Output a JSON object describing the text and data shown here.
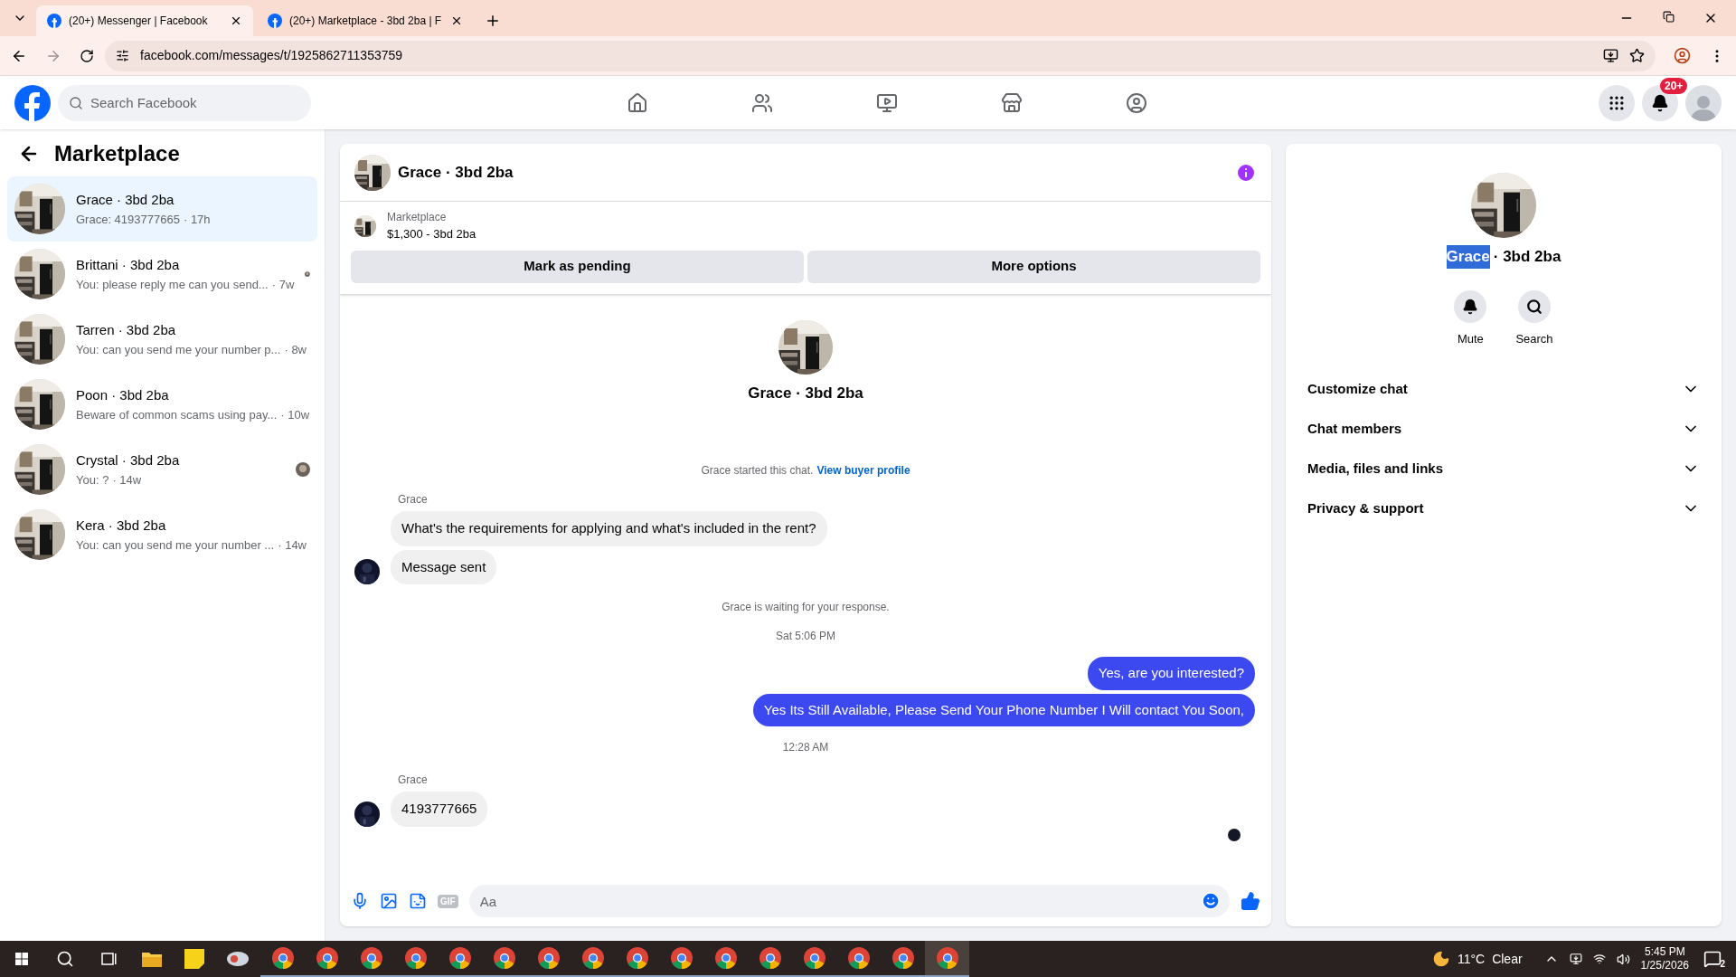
{
  "browser": {
    "tabs": [
      {
        "title": "(20+) Messenger | Facebook",
        "selected": true
      },
      {
        "title": "(20+) Marketplace - 3bd 2ba | F",
        "selected": false
      }
    ],
    "url": "facebook.com/messages/t/1925862711353759"
  },
  "topbar": {
    "search": {
      "placeholder": "Search Facebook"
    },
    "nav": [
      {
        "kind": "home",
        "selected": false
      },
      {
        "kind": "friends",
        "selected": false
      },
      {
        "kind": "video",
        "selected": false
      },
      {
        "kind": "marketplace",
        "selected": false
      },
      {
        "kind": "groups",
        "selected": false
      }
    ],
    "notification_badge": "20+"
  },
  "sidebar": {
    "title": "Marketplace",
    "items": [
      {
        "name": "Grace · 3bd 2ba",
        "preview": "Grace: 4193777665",
        "time": "· 17h",
        "selected": true,
        "seen_avatar": false
      },
      {
        "name": "Brittani · 3bd 2ba",
        "preview": "You: please reply me can you send...",
        "time": "· 7w",
        "selected": false,
        "seen_avatar": true
      },
      {
        "name": "Tarren · 3bd 2ba",
        "preview": "You: can you send me your number p...",
        "time": "· 8w",
        "selected": false,
        "seen_avatar": false
      },
      {
        "name": "Poon · 3bd 2ba",
        "preview": "Beware of common scams using pay...",
        "time": "· 10w",
        "selected": false,
        "seen_avatar": false
      },
      {
        "name": "Crystal · 3bd 2ba",
        "preview": "You: ?",
        "time": "· 14w",
        "selected": false,
        "seen_avatar": true
      },
      {
        "name": "Kera · 3bd 2ba",
        "preview": "You: can you send me your number ...",
        "time": "· 14w",
        "selected": false,
        "seen_avatar": false
      }
    ]
  },
  "chat": {
    "title": "Grace · 3bd 2ba",
    "listing": {
      "label": "Marketplace",
      "detail": "$1,300 - 3bd 2ba"
    },
    "buttons": [
      "Mark as pending",
      "More options"
    ],
    "intro_name": "Grace · 3bd 2ba",
    "started": {
      "text": "Grace started this chat.",
      "link": "View buyer profile"
    },
    "messages": [
      {
        "kind": "sender",
        "text": "Grace"
      },
      {
        "kind": "incoming",
        "text": "What's the requirements for applying and what's included in the rent?",
        "avatar": false
      },
      {
        "kind": "incoming",
        "text": "Message sent",
        "avatar": true
      },
      {
        "kind": "system",
        "text": "Grace is waiting for your response."
      },
      {
        "kind": "time",
        "text": "Sat 5:06 PM"
      },
      {
        "kind": "outgoing",
        "text": "Yes, are you interested?"
      },
      {
        "kind": "outgoing",
        "text": "Yes Its Still Available, Please Send Your Phone Number I Will contact You Soon,"
      },
      {
        "kind": "time",
        "text": "12:28 AM"
      },
      {
        "kind": "sender",
        "text": "Grace"
      },
      {
        "kind": "incoming",
        "text": "4193777665",
        "avatar": true
      }
    ],
    "seen": true,
    "composer": {
      "gif": "GIF",
      "placeholder": "Aa"
    }
  },
  "info_panel": {
    "name": "Grace",
    "name_selected": true,
    "suffix": "· 3bd 2ba",
    "actions": [
      "Mute",
      "Search"
    ],
    "sections": [
      {
        "label": "Customize chat",
        "expanded": false
      },
      {
        "label": "Chat members",
        "expanded": false
      },
      {
        "label": "Media, files and links",
        "expanded": false
      },
      {
        "label": "Privacy & support",
        "expanded": false
      }
    ]
  },
  "taskbar": {
    "apps": [
      {
        "selected": false
      },
      {
        "selected": false
      },
      {
        "selected": false
      },
      {
        "selected": false
      },
      {
        "selected": false
      },
      {
        "selected": false
      },
      {
        "selected": false
      },
      {
        "selected": false
      },
      {
        "selected": false
      },
      {
        "selected": false
      },
      {
        "selected": false
      },
      {
        "selected": false
      },
      {
        "selected": false
      },
      {
        "selected": false
      },
      {
        "selected": false
      },
      {
        "selected": true
      }
    ],
    "weather": "11°C",
    "condition": "Clear",
    "time": "5:45 PM",
    "date": "1/25/2026",
    "notifications": "2"
  }
}
